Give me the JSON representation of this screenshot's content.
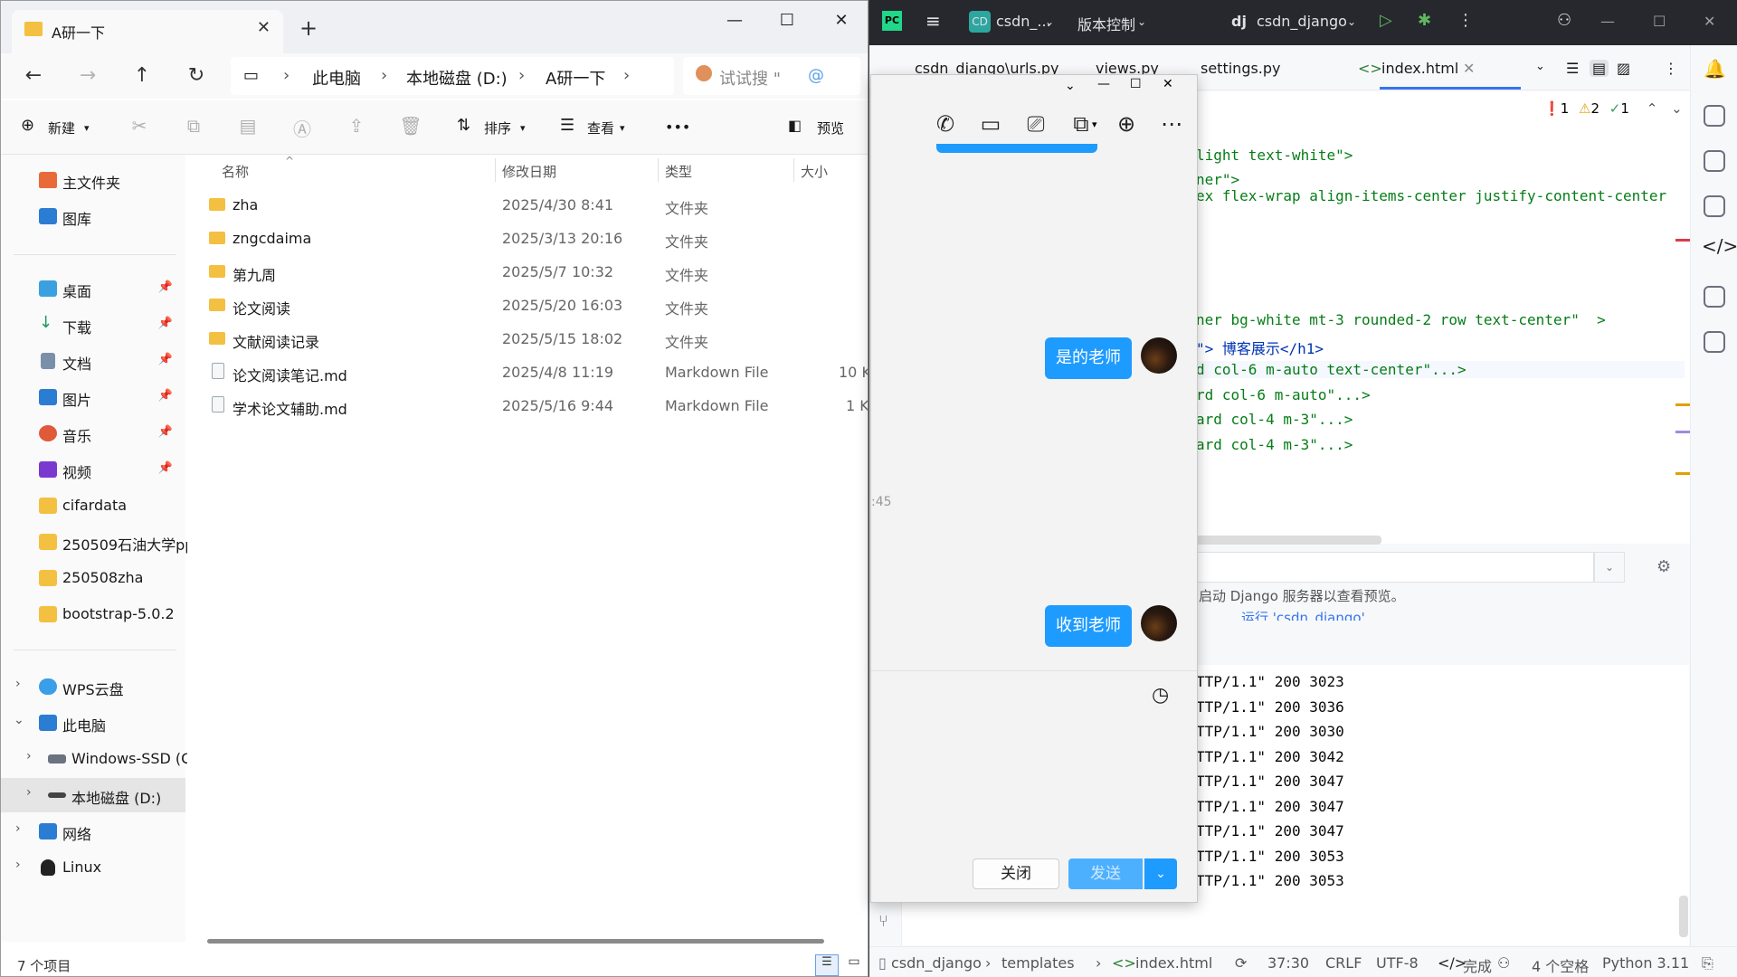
{
  "explorer": {
    "tab_title": "A研一下",
    "tab_close": "✕",
    "new_tab": "+",
    "window_controls": {
      "minimize": "—",
      "maximize": "☐",
      "close": "✕"
    },
    "breadcrumb": [
      "此电脑",
      "本地磁盘 (D:)",
      "A研一下"
    ],
    "search_placeholder": "试试搜 \"",
    "toolbar": {
      "new": "新建",
      "sort": "排序",
      "view": "查看",
      "more": "•••",
      "preview": "预览"
    },
    "sidebar": {
      "home": "主文件夹",
      "gallery": "图库",
      "pinned": [
        "桌面",
        "下载",
        "文档",
        "图片",
        "音乐",
        "视频"
      ],
      "folders": [
        "cifardata",
        "250509石油大学pp",
        "250508zha",
        "bootstrap-5.0.2"
      ],
      "wps": "WPS云盘",
      "this_pc": "此电脑",
      "drive_c": "Windows-SSD (C:",
      "drive_d": "本地磁盘 (D:)",
      "network": "网络",
      "linux": "Linux"
    },
    "columns": {
      "name": "名称",
      "date": "修改日期",
      "type": "类型",
      "size": "大小"
    },
    "files": [
      {
        "name": "zha",
        "date": "2025/4/30 8:41",
        "type": "文件夹",
        "size": ""
      },
      {
        "name": "zngcdaima",
        "date": "2025/3/13 20:16",
        "type": "文件夹",
        "size": ""
      },
      {
        "name": "第九周",
        "date": "2025/5/7 10:32",
        "type": "文件夹",
        "size": ""
      },
      {
        "name": "论文阅读",
        "date": "2025/5/20 16:03",
        "type": "文件夹",
        "size": ""
      },
      {
        "name": "文献阅读记录",
        "date": "2025/5/15 18:02",
        "type": "文件夹",
        "size": ""
      },
      {
        "name": "论文阅读笔记.md",
        "date": "2025/4/8 11:19",
        "type": "Markdown File",
        "size": "10 K"
      },
      {
        "name": "学术论文辅助.md",
        "date": "2025/5/16 9:44",
        "type": "Markdown File",
        "size": "1 K"
      }
    ],
    "status": "7 个项目",
    "accent": "#f3c041"
  },
  "ide": {
    "logo": "PC",
    "project_badge": "CD",
    "project": "csdn_...",
    "vcs": "版本控制",
    "run_config_prefix": "dj",
    "run_config": "csdn_django",
    "tabs": [
      "csdn_django\\urls.py",
      "views.py",
      "settings.py",
      "index.html"
    ],
    "inspections": {
      "errors": "1",
      "warnings": "2",
      "ok": "1"
    },
    "code_lines": [
      {
        "text": "light text-white\">",
        "kind": "str"
      },
      {
        "text": "ner\">",
        "kind": "str"
      },
      {
        "text": "ex flex-wrap align-items-center justify-content-center",
        "kind": "str"
      },
      {
        "text": "ner bg-white mt-3 rounded-2 row text-center\"  >",
        "kind": "str"
      },
      {
        "text": "\"> 博客展示</h1>",
        "kind": "tag"
      },
      {
        "text": "d col-6 m-auto text-center\"...>",
        "kind": "str"
      },
      {
        "text": "rd col-6 m-auto\"...>",
        "kind": "str"
      },
      {
        "text": "ard col-4 m-3\"...>",
        "kind": "str"
      },
      {
        "text": "ard col-4 m-3\"...>",
        "kind": "str"
      }
    ],
    "preview_msg": "启动 Django 服务器以查看预览。",
    "run_link": "运行 'csdn_django'",
    "console_lines": [
      "TTP/1.1\" 200 3023",
      "TTP/1.1\" 200 3036",
      "TTP/1.1\" 200 3030",
      "TTP/1.1\" 200 3042",
      "TTP/1.1\" 200 3047",
      "TTP/1.1\" 200 3047",
      "TTP/1.1\" 200 3047",
      "TTP/1.1\" 200 3053",
      "TTP/1.1\" 200 3053"
    ],
    "status": {
      "project": "csdn_django",
      "folder": "templates",
      "file": "index.html",
      "position": "37:30",
      "line_sep": "CRLF",
      "encoding": "UTF-8",
      "done": "完成",
      "indent": "4 个空格",
      "interpreter": "Python 3.11"
    }
  },
  "chat": {
    "time_fragment": ":45",
    "messages": [
      {
        "text": "是的老师"
      },
      {
        "text": "收到老师"
      }
    ],
    "close_button": "关闭",
    "send_button": "发送",
    "accent": "#1e9bff"
  }
}
